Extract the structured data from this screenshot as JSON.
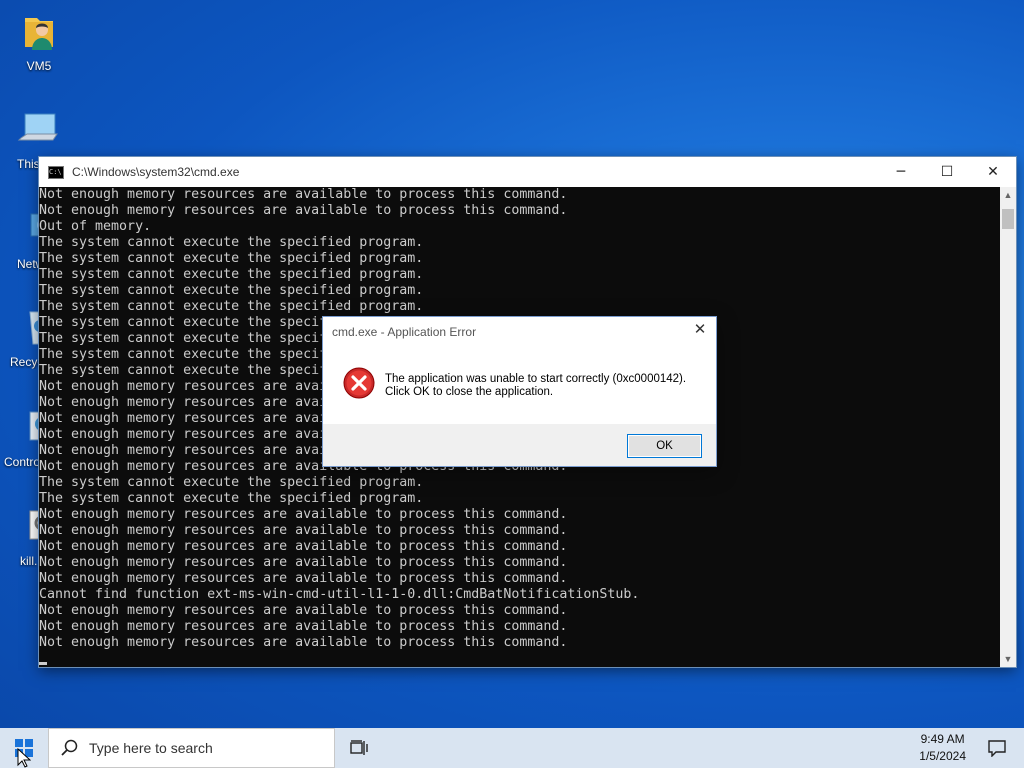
{
  "desktop": {
    "icons": [
      {
        "label": "VM5",
        "icon": "user-folder-icon"
      },
      {
        "label": "This",
        "icon": "computer-icon"
      },
      {
        "label": "Netw",
        "icon": "network-icon"
      },
      {
        "label": "Recyc",
        "icon": "recycle-bin-icon"
      },
      {
        "label": "Contro",
        "icon": "control-panel-icon"
      },
      {
        "label": "kill.",
        "icon": "settings-file-icon"
      }
    ]
  },
  "cmd_window": {
    "title": "C:\\Windows\\system32\\cmd.exe",
    "minimize": "─",
    "maximize": "☐",
    "close": "✕",
    "lines": [
      "Not enough memory resources are available to process this command.",
      "Not enough memory resources are available to process this command.",
      "Out of memory.",
      "The system cannot execute the specified program.",
      "The system cannot execute the specified program.",
      "The system cannot execute the specified program.",
      "The system cannot execute the specified program.",
      "The system cannot execute the specified program.",
      "The system cannot execute the specified program.",
      "The system cannot execute the specified program.",
      "The system cannot execute the specified program.",
      "The system cannot execute the specified program.",
      "Not enough memory resources are available to process this command.",
      "Not enough memory resources are available to process this command.",
      "Not enough memory resources are available to process this command.",
      "Not enough memory resources are available to process this command.",
      "Not enough memory resources are available to process this command.",
      "Not enough memory resources are available to process this command.",
      "The system cannot execute the specified program.",
      "The system cannot execute the specified program.",
      "Not enough memory resources are available to process this command.",
      "Not enough memory resources are available to process this command.",
      "Not enough memory resources are available to process this command.",
      "Not enough memory resources are available to process this command.",
      "Not enough memory resources are available to process this command.",
      "Cannot find function ext-ms-win-cmd-util-l1-1-0.dll:CmdBatNotificationStub.",
      "Not enough memory resources are available to process this command.",
      "Not enough memory resources are available to process this command.",
      "Not enough memory resources are available to process this command."
    ]
  },
  "error_dialog": {
    "title": "cmd.exe - Application Error",
    "close": "✕",
    "message_line1": "The application was unable to start correctly (0xc0000142).",
    "message_line2": "Click OK to close the application.",
    "ok_label": "OK"
  },
  "taskbar": {
    "search_placeholder": "Type here to search",
    "time": "9:49 AM",
    "date": "1/5/2024"
  }
}
